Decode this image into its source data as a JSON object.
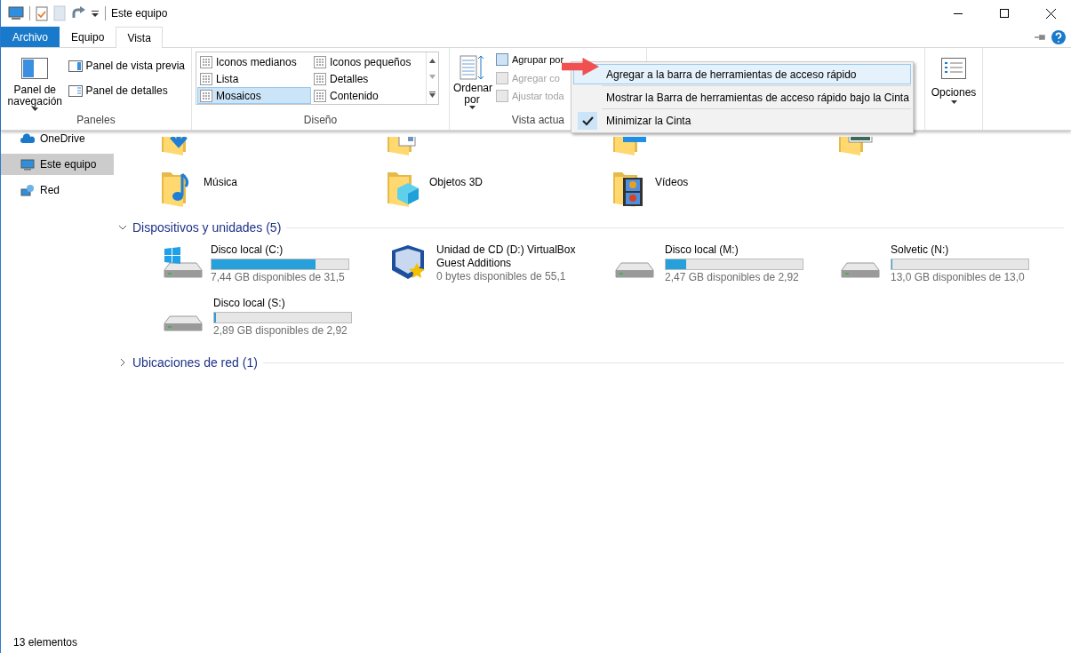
{
  "window": {
    "title": "Este equipo"
  },
  "ribbon_tabs": [
    {
      "label": "Archivo",
      "kind": "file",
      "selected": false
    },
    {
      "label": "Equipo",
      "kind": "tab",
      "selected": false
    },
    {
      "label": "Vista",
      "kind": "tab",
      "selected": true
    }
  ],
  "ribbon": {
    "panes": {
      "label": "Paneles",
      "navigation_pane": "Panel de navegación",
      "items": [
        {
          "label": "Panel de vista previa",
          "kind": "preview"
        },
        {
          "label": "Panel de detalles",
          "kind": "details"
        }
      ]
    },
    "layout": {
      "label": "Diseño",
      "options": [
        {
          "label": "Iconos medianos",
          "selected": false
        },
        {
          "label": "Iconos pequeños",
          "selected": false
        },
        {
          "label": "Lista",
          "selected": false
        },
        {
          "label": "Detalles",
          "selected": false
        },
        {
          "label": "Mosaicos",
          "selected": true
        },
        {
          "label": "Contenido",
          "selected": false
        }
      ]
    },
    "current_view": {
      "label": "Vista actua",
      "sort": "Ordenar por",
      "items": [
        {
          "label": "Agrupar por",
          "disabled": false
        },
        {
          "label": "Agregar co",
          "disabled": true
        },
        {
          "label": "Ajustar toda",
          "disabled": true
        }
      ]
    },
    "options": {
      "label": "Opciones"
    }
  },
  "context_menu": {
    "items": [
      {
        "label": "Agregar a la barra de herramientas de acceso rápido",
        "checked": false,
        "highlighted": true
      },
      {
        "label": "Mostrar la Barra de herramientas de acceso rápido bajo la Cinta",
        "checked": false,
        "highlighted": false
      },
      {
        "label": "Minimizar la Cinta",
        "checked": true,
        "highlighted": false
      }
    ]
  },
  "sidebar": {
    "items": [
      {
        "label": "OneDrive",
        "kind": "cloud",
        "selected": false
      },
      {
        "label": "Este equipo",
        "kind": "computer",
        "selected": true
      },
      {
        "label": "Red",
        "kind": "network",
        "selected": false
      }
    ]
  },
  "folders": [
    {
      "kind": "downloads"
    },
    {
      "kind": "documents"
    },
    {
      "kind": "desktop"
    },
    {
      "kind": "pictures"
    },
    {
      "kind": "music",
      "label": "Música"
    },
    {
      "kind": "objects3d",
      "label": "Objetos 3D"
    },
    {
      "kind": "videos",
      "label": "Vídeos"
    }
  ],
  "sections": [
    {
      "title": "Dispositivos y unidades (5)",
      "expanded": true,
      "drives": [
        {
          "kind": "windows",
          "label": "Disco local (C:)",
          "level": 0.76,
          "free": "7,44 GB disponibles de 31,5"
        },
        {
          "kind": "cd",
          "label": "Unidad de CD (D:) VirtualBox",
          "label_line2": "Guest Additions",
          "free": "0 bytes disponibles de 55,1"
        },
        {
          "kind": "hdd",
          "label": "Disco local (M:)",
          "level": 0.15,
          "free": "2,47 GB disponibles de 2,92"
        },
        {
          "kind": "hdd",
          "label": "Solvetic (N:)",
          "level": 0.0,
          "free": "13,0 GB disponibles de 13,0"
        },
        {
          "kind": "hdd",
          "label": "Disco local (S:)",
          "level": 0.01,
          "free": "2,89 GB disponibles de 2,92"
        }
      ]
    },
    {
      "title": "Ubicaciones de red (1)",
      "expanded": false
    }
  ],
  "status_bar": {
    "text": "13 elementos"
  }
}
